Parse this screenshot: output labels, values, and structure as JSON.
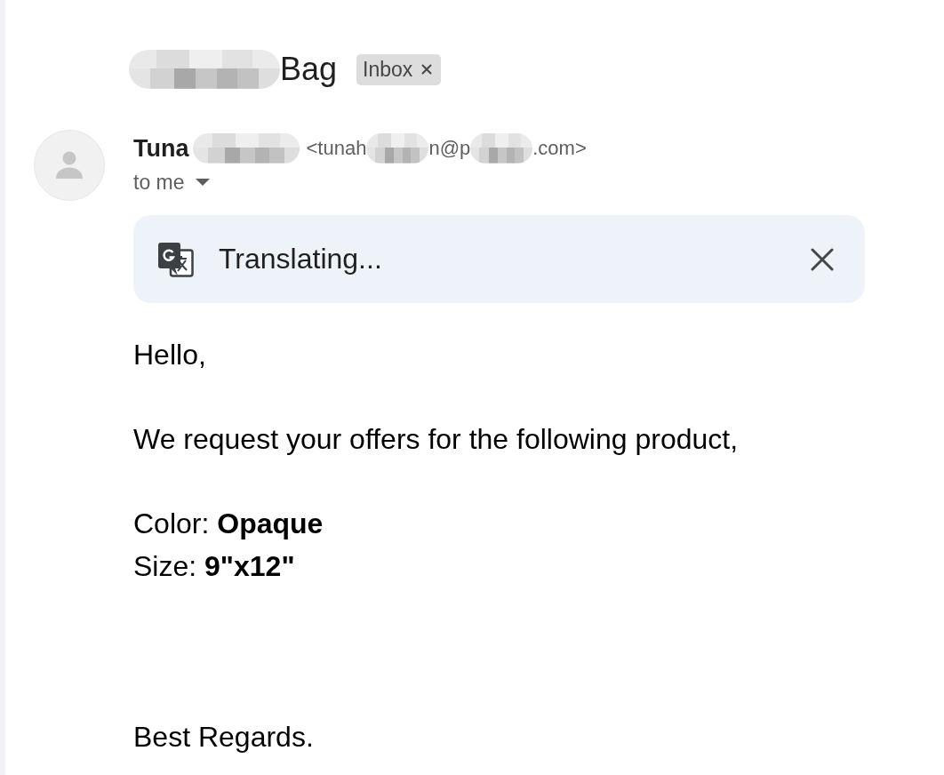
{
  "subject": {
    "segments": [
      {
        "kind": "redacted"
      },
      {
        "kind": "text",
        "text": "Bag"
      }
    ],
    "labels": [
      {
        "text": "Inbox",
        "removable": true
      }
    ]
  },
  "sender": {
    "name_segments": [
      {
        "kind": "text",
        "text": "Tuna"
      },
      {
        "kind": "redacted"
      }
    ],
    "email_segments": [
      {
        "kind": "text",
        "text": "<tunah"
      },
      {
        "kind": "redacted"
      },
      {
        "kind": "text",
        "text": "n@p"
      },
      {
        "kind": "redacted"
      },
      {
        "kind": "text",
        "text": ".com>"
      }
    ],
    "recipients": "to me"
  },
  "translation_banner": {
    "status": "Translating..."
  },
  "body": {
    "paragraphs": [
      [
        "Hello,"
      ],
      [
        "We request your offers for the following product,"
      ],
      [
        "Color: **Opaque**",
        "Size: **9\"x12\"**"
      ]
    ],
    "closing": "Best Regards."
  }
}
